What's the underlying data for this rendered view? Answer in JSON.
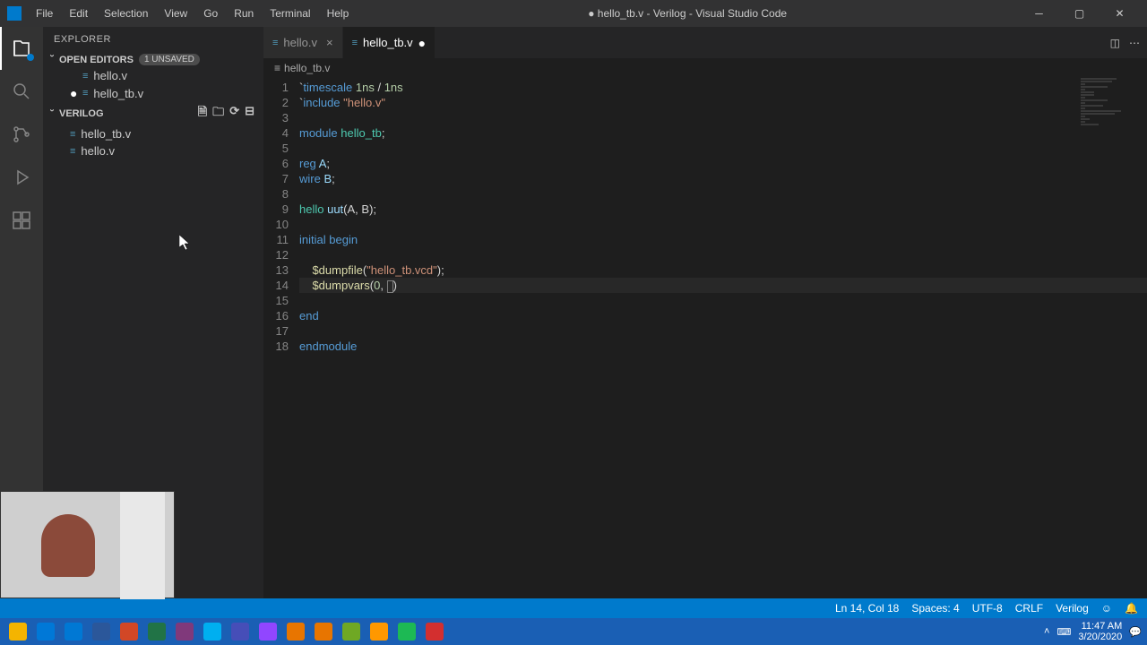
{
  "menu": [
    "File",
    "Edit",
    "Selection",
    "View",
    "Go",
    "Run",
    "Terminal",
    "Help"
  ],
  "window_title": "● hello_tb.v - Verilog - Visual Studio Code",
  "sidebar": {
    "title": "EXPLORER",
    "open_editors": {
      "label": "OPEN EDITORS",
      "badge": "1 UNSAVED",
      "items": [
        {
          "name": "hello.v",
          "modified": false
        },
        {
          "name": "hello_tb.v",
          "modified": true
        }
      ]
    },
    "workspace": {
      "label": "VERILOG",
      "items": [
        {
          "name": "hello_tb.v"
        },
        {
          "name": "hello.v"
        }
      ]
    }
  },
  "tabs": [
    {
      "name": "hello.v",
      "active": false,
      "modified": false
    },
    {
      "name": "hello_tb.v",
      "active": true,
      "modified": true
    }
  ],
  "breadcrumb": "hello_tb.v",
  "code_lines": [
    {
      "n": 1,
      "tokens": [
        [
          "tk-text",
          "`"
        ],
        [
          "tk-keyword",
          "timescale"
        ],
        [
          "tk-text",
          " "
        ],
        [
          "tk-number",
          "1ns"
        ],
        [
          "tk-text",
          " / "
        ],
        [
          "tk-number",
          "1ns"
        ]
      ]
    },
    {
      "n": 2,
      "tokens": [
        [
          "tk-text",
          "`"
        ],
        [
          "tk-keyword",
          "include"
        ],
        [
          "tk-text",
          " "
        ],
        [
          "tk-string",
          "\"hello.v\""
        ]
      ]
    },
    {
      "n": 3,
      "tokens": []
    },
    {
      "n": 4,
      "tokens": [
        [
          "tk-keyword",
          "module"
        ],
        [
          "tk-text",
          " "
        ],
        [
          "tk-module",
          "hello_tb"
        ],
        [
          "tk-text",
          ";"
        ]
      ]
    },
    {
      "n": 5,
      "tokens": []
    },
    {
      "n": 6,
      "tokens": [
        [
          "tk-keyword",
          "reg"
        ],
        [
          "tk-text",
          " "
        ],
        [
          "tk-ident",
          "A"
        ],
        [
          "tk-text",
          ";"
        ]
      ]
    },
    {
      "n": 7,
      "tokens": [
        [
          "tk-keyword",
          "wire"
        ],
        [
          "tk-text",
          " "
        ],
        [
          "tk-ident",
          "B"
        ],
        [
          "tk-text",
          ";"
        ]
      ]
    },
    {
      "n": 8,
      "tokens": []
    },
    {
      "n": 9,
      "tokens": [
        [
          "tk-module",
          "hello"
        ],
        [
          "tk-text",
          " "
        ],
        [
          "tk-ident",
          "uut"
        ],
        [
          "tk-text",
          "(A, B);"
        ]
      ]
    },
    {
      "n": 10,
      "tokens": []
    },
    {
      "n": 11,
      "tokens": [
        [
          "tk-keyword",
          "initial"
        ],
        [
          "tk-text",
          " "
        ],
        [
          "tk-keyword",
          "begin"
        ]
      ]
    },
    {
      "n": 12,
      "tokens": []
    },
    {
      "n": 13,
      "tokens": [
        [
          "tk-text",
          "    "
        ],
        [
          "tk-func",
          "$dumpfile"
        ],
        [
          "tk-text",
          "("
        ],
        [
          "tk-string",
          "\"hello_tb.vcd\""
        ],
        [
          "tk-text",
          ");"
        ]
      ]
    },
    {
      "n": 14,
      "current": true,
      "tokens": [
        [
          "tk-text",
          "    "
        ],
        [
          "tk-func",
          "$dumpvars"
        ],
        [
          "tk-text",
          "("
        ],
        [
          "tk-number",
          "0"
        ],
        [
          "tk-text",
          ", "
        ],
        [
          "cursor",
          ""
        ],
        [
          "tk-text",
          ")"
        ]
      ]
    },
    {
      "n": 15,
      "tokens": []
    },
    {
      "n": 16,
      "tokens": [
        [
          "tk-keyword",
          "end"
        ]
      ]
    },
    {
      "n": 17,
      "tokens": []
    },
    {
      "n": 18,
      "tokens": [
        [
          "tk-keyword",
          "endmodule"
        ]
      ]
    }
  ],
  "status": {
    "position": "Ln 14, Col 18",
    "spaces": "Spaces: 4",
    "encoding": "UTF-8",
    "eol": "CRLF",
    "language": "Verilog",
    "feedback": "☺"
  },
  "taskbar": {
    "icons": [
      "chrome",
      "vscode",
      "outlook",
      "word",
      "powerpoint",
      "excel",
      "onenote",
      "skype",
      "teams",
      "epic",
      "matlab",
      "matlab2",
      "camtasia",
      "photos",
      "spotify",
      "c"
    ],
    "colors": [
      "#f4b400",
      "#0078d7",
      "#0078d4",
      "#2b579a",
      "#d24726",
      "#217346",
      "#80397b",
      "#00aff0",
      "#464eb8",
      "#9146ff",
      "#e87500",
      "#e87500",
      "#6fa824",
      "#ff9800",
      "#1db954",
      "#d32f2f"
    ],
    "time": "11:47 AM",
    "date": "3/20/2020"
  }
}
